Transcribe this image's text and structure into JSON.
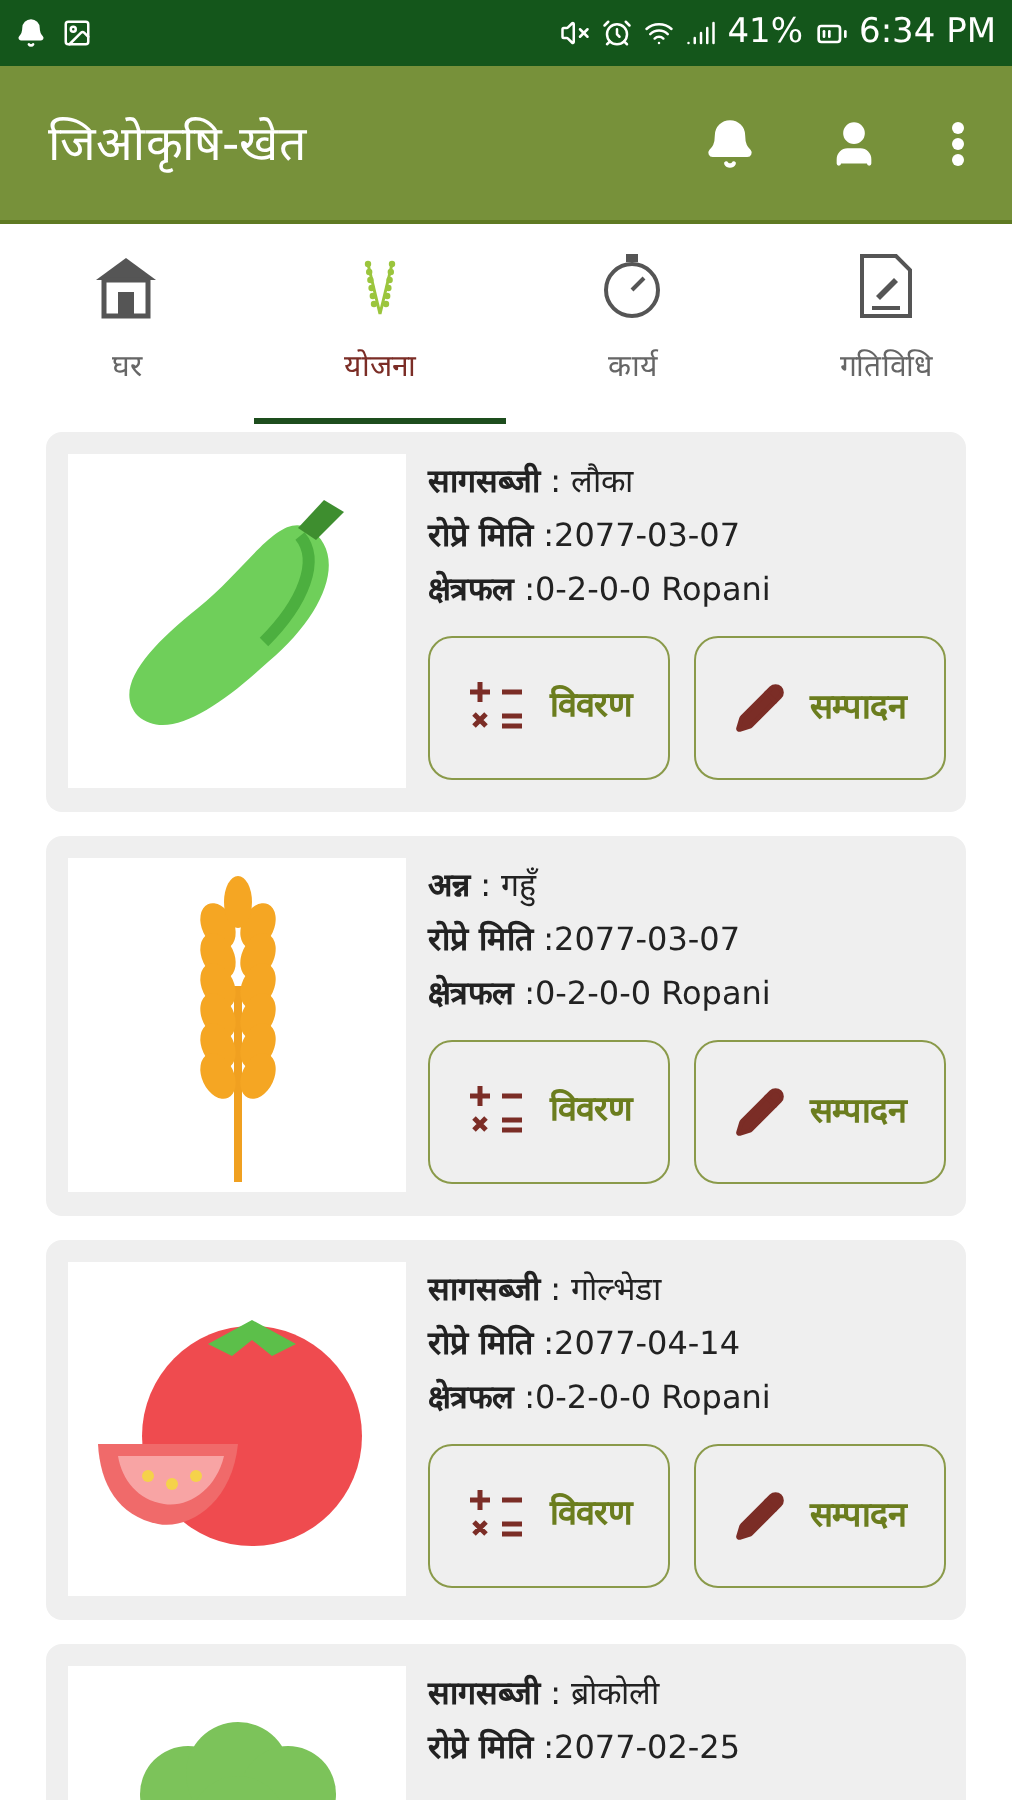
{
  "status_bar": {
    "battery": "41%",
    "time": "6:34 PM"
  },
  "app_bar": {
    "title": "जिओकृषि-खेत"
  },
  "tabs": [
    {
      "label": "घर",
      "kind": "home",
      "selected": false
    },
    {
      "label": "योजना",
      "kind": "plan",
      "selected": true
    },
    {
      "label": "कार्य",
      "kind": "task",
      "selected": false
    },
    {
      "label": "गतिविधि",
      "kind": "activity",
      "selected": false
    }
  ],
  "cards": [
    {
      "kind": "gourd",
      "fields": [
        {
          "label": "सागसब्जी",
          "value": " : लौका"
        },
        {
          "label": "रोप्रे मिति",
          "value": " :2077-03-07"
        },
        {
          "label": "क्षेत्रफल",
          "value": " :0-2-0-0 Ropani"
        }
      ],
      "buttons": [
        "विवरण",
        "सम्पादन"
      ]
    },
    {
      "kind": "wheat",
      "fields": [
        {
          "label": "अन्न",
          "value": " : गहुँ"
        },
        {
          "label": "रोप्रे मिति",
          "value": " :2077-03-07"
        },
        {
          "label": "क्षेत्रफल",
          "value": " :0-2-0-0 Ropani"
        }
      ],
      "buttons": [
        "विवरण",
        "सम्पादन"
      ]
    },
    {
      "kind": "tomato",
      "fields": [
        {
          "label": "सागसब्जी",
          "value": " : गोल्भेडा"
        },
        {
          "label": "रोप्रे मिति",
          "value": " :2077-04-14"
        },
        {
          "label": "क्षेत्रफल",
          "value": " :0-2-0-0 Ropani"
        }
      ],
      "buttons": [
        "विवरण",
        "सम्पादन"
      ]
    },
    {
      "kind": "broccoli",
      "fields": [
        {
          "label": "सागसब्जी",
          "value": " : ब्रोकोली"
        },
        {
          "label": "रोप्रे मिति",
          "value": " :2077-02-25"
        }
      ]
    }
  ]
}
